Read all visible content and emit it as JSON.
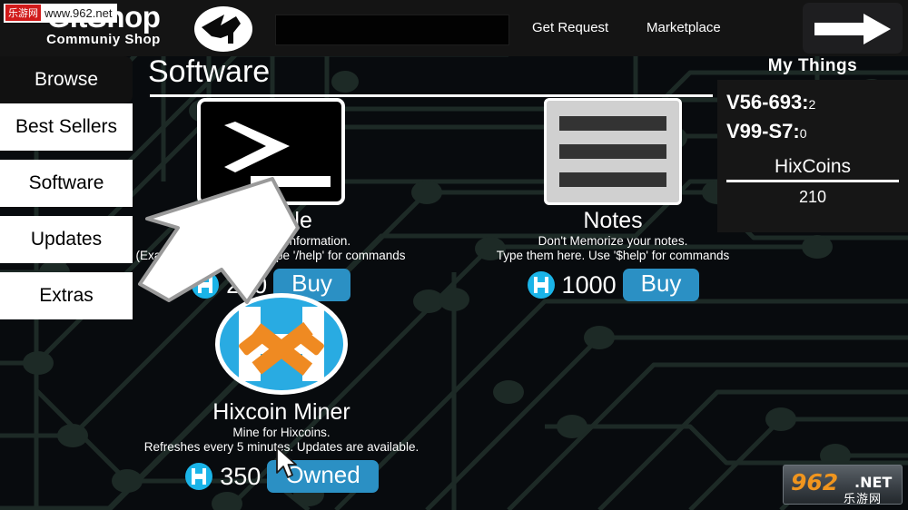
{
  "colors": {
    "accent_blue": "#2b90c4",
    "coin_cyan": "#1ab4e8",
    "miner_orange": "#ef8a22",
    "background": "#080b0e",
    "circuit_trace": "#1d2a26",
    "topbar": "#141414",
    "panel": "#161616"
  },
  "brand": {
    "title": "GitShop",
    "subtitle": "Communiy Shop",
    "logo_icon": "wolf-head-icon"
  },
  "topnav": {
    "search": {
      "value": "",
      "placeholder": ""
    },
    "links": [
      {
        "label": "Get Request"
      },
      {
        "label": "Marketplace"
      }
    ],
    "forward_button": {
      "icon": "arrow-right-icon"
    }
  },
  "sidebar": {
    "items": [
      {
        "label": "Browse",
        "style": "dark"
      },
      {
        "label": "Best Sellers",
        "style": "light"
      },
      {
        "label": "Software",
        "style": "light"
      },
      {
        "label": "Updates",
        "style": "light"
      },
      {
        "label": "Extras",
        "style": "light"
      }
    ]
  },
  "page": {
    "title": "Software"
  },
  "my_things": {
    "heading": "My Things",
    "items": [
      {
        "name": "V56-693:",
        "qty": "2"
      },
      {
        "name": "V99-S7:",
        "qty": "0"
      }
    ],
    "currency_label": "HixCoins",
    "currency_value": "210"
  },
  "products": [
    {
      "id": "console",
      "name": "Console",
      "icon": "terminal-icon",
      "desc_line1": "Useful for getting information.",
      "desc_line2": "(Example: User Info/IP)Type '/help' for commands",
      "price": "250",
      "coin_icon": "hixcoin-icon",
      "action_label": "Buy",
      "owned": false
    },
    {
      "id": "notes",
      "name": "Notes",
      "icon": "notes-icon",
      "desc_line1": "Don't Memorize your notes.",
      "desc_line2": "Type them here. Use '$help' for commands",
      "price": "1000",
      "coin_icon": "hixcoin-icon",
      "action_label": "Buy",
      "owned": false
    },
    {
      "id": "hixcoin-miner",
      "name": "Hixcoin Miner",
      "icon": "hixcoin-miner-icon",
      "desc_line1": "Mine for Hixcoins.",
      "desc_line2": "Refreshes every 5 minutes. Updates are available.",
      "price": "350",
      "coin_icon": "hixcoin-icon",
      "action_label": "Owned",
      "owned": true
    }
  ],
  "overlays": {
    "big_arrow": "arrow-pointing-down-left-icon",
    "mouse_cursor": "mouse-pointer-icon"
  },
  "watermarks": {
    "top": {
      "badge": "乐游网",
      "url": "www.962.net"
    },
    "bottom": {
      "number": "962",
      "tld": ".NET",
      "hanzi": "乐游网"
    }
  }
}
